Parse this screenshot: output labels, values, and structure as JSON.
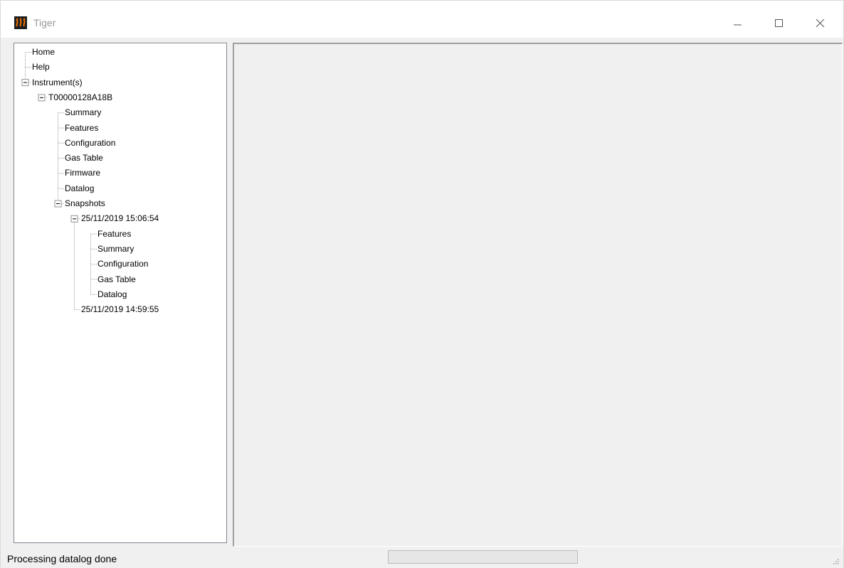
{
  "window": {
    "title": "Tiger",
    "accent": "#ff7a00"
  },
  "titlebar_controls": {
    "minimize_icon": "minimize-icon",
    "maximize_icon": "maximize-icon",
    "close_icon": "close-icon"
  },
  "tree": {
    "nodes": [
      {
        "label": "Home",
        "depth": 0,
        "expander": false,
        "expanded": false
      },
      {
        "label": "Help",
        "depth": 0,
        "expander": false,
        "expanded": false
      },
      {
        "label": "Instrument(s)",
        "depth": 0,
        "expander": true,
        "expanded": true
      },
      {
        "label": "T00000128A18B",
        "depth": 1,
        "expander": true,
        "expanded": true
      },
      {
        "label": "Summary",
        "depth": 2,
        "expander": false,
        "expanded": false
      },
      {
        "label": "Features",
        "depth": 2,
        "expander": false,
        "expanded": false
      },
      {
        "label": "Configuration",
        "depth": 2,
        "expander": false,
        "expanded": false
      },
      {
        "label": "Gas Table",
        "depth": 2,
        "expander": false,
        "expanded": false
      },
      {
        "label": "Firmware",
        "depth": 2,
        "expander": false,
        "expanded": false
      },
      {
        "label": "Datalog",
        "depth": 2,
        "expander": false,
        "expanded": false
      },
      {
        "label": "Snapshots",
        "depth": 2,
        "expander": true,
        "expanded": true
      },
      {
        "label": "25/11/2019 15:06:54",
        "depth": 3,
        "expander": true,
        "expanded": true
      },
      {
        "label": "Features",
        "depth": 4,
        "expander": false,
        "expanded": false
      },
      {
        "label": "Summary",
        "depth": 4,
        "expander": false,
        "expanded": false
      },
      {
        "label": "Configuration",
        "depth": 4,
        "expander": false,
        "expanded": false
      },
      {
        "label": "Gas Table",
        "depth": 4,
        "expander": false,
        "expanded": false
      },
      {
        "label": "Datalog",
        "depth": 4,
        "expander": false,
        "expanded": false
      },
      {
        "label": "25/11/2019 14:59:55",
        "depth": 3,
        "expander": false,
        "expanded": false
      }
    ]
  },
  "statusbar": {
    "text": "Processing datalog done",
    "progress": 0
  }
}
